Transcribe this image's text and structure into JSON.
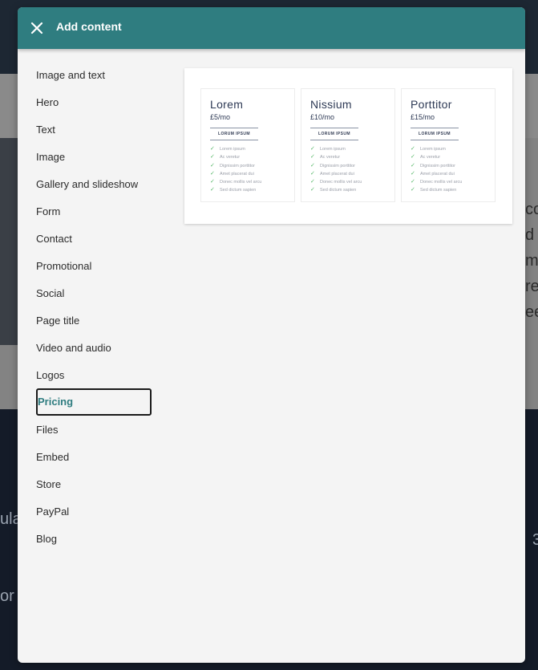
{
  "background": {
    "partial_text_right": [
      "co",
      "d",
      "m",
      "rec",
      "ee"
    ],
    "partial_text_bottom": [
      "ula",
      "or",
      "3"
    ]
  },
  "modal": {
    "title": "Add content",
    "close_icon": "close-icon",
    "colors": {
      "header": "#2f7d80",
      "selected_text": "#2f7d80",
      "check": "#58b86a"
    },
    "items": [
      "Image and text",
      "Hero",
      "Text",
      "Image",
      "Gallery and slideshow",
      "Form",
      "Contact",
      "Promotional",
      "Social",
      "Page title",
      "Video and audio",
      "Logos",
      "Pricing",
      "Files",
      "Embed",
      "Store",
      "PayPal",
      "Blog"
    ],
    "selected_item": "Pricing",
    "preview": {
      "cards": [
        {
          "name": "Lorem",
          "price": "£5/mo",
          "button": "LORUM IPSUM",
          "features": [
            "Lorem ipsum",
            "Ac veretur",
            "Dignissim porttitor",
            "Amet placerat dui",
            "Donec mollis vel arcu",
            "Sed dictum sapien"
          ]
        },
        {
          "name": "Nissium",
          "price": "£10/mo",
          "button": "LORUM IPSUM",
          "features": [
            "Lorem ipsum",
            "Ac veretur",
            "Dignissim porttitor",
            "Amet placerat dui",
            "Donec mollis vel arcu",
            "Sed dictum sapien"
          ]
        },
        {
          "name": "Porttitor",
          "price": "£15/mo",
          "button": "LORUM IPSUM",
          "features": [
            "Lorem ipsum",
            "Ac veretur",
            "Dignissim porttitor",
            "Amet placerat dui",
            "Donec mollis vel arcu",
            "Sed dictum sapien"
          ]
        }
      ]
    }
  }
}
